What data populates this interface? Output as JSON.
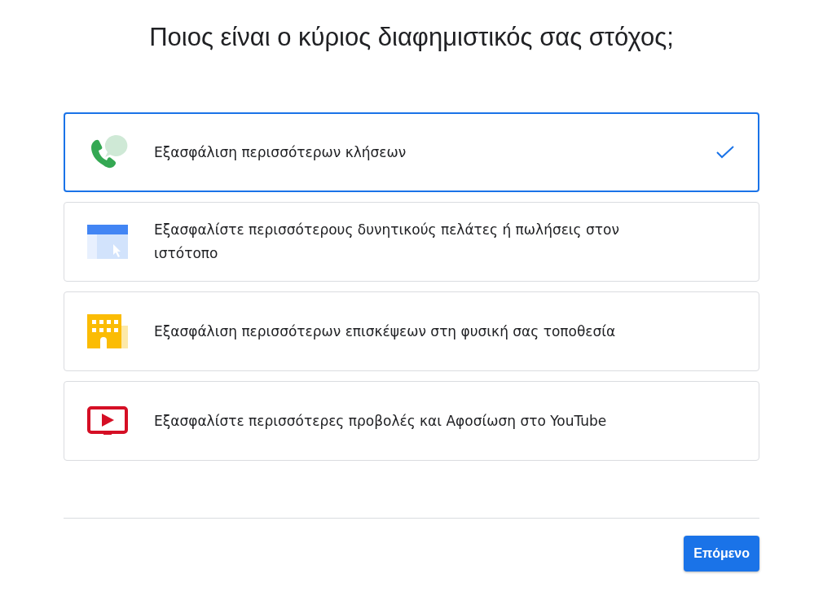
{
  "title": "Ποιος είναι ο κύριος διαφημιστικός σας στόχος;",
  "options": [
    {
      "kind": "calls",
      "label": "Εξασφάλιση περισσότερων κλήσεων",
      "selected": true
    },
    {
      "kind": "website",
      "label": "Εξασφαλίστε περισσότερους δυνητικούς πελάτες ή πωλήσεις στον ιστότοπο",
      "selected": false
    },
    {
      "kind": "visits",
      "label": "Εξασφάλιση περισσότερων επισκέψεων στη φυσική σας τοποθεσία",
      "selected": false
    },
    {
      "kind": "youtube",
      "label": "Εξασφαλίστε περισσότερες προβολές και Αφοσίωση στο YouTube",
      "selected": false
    }
  ],
  "next_button": "Επόμενο"
}
